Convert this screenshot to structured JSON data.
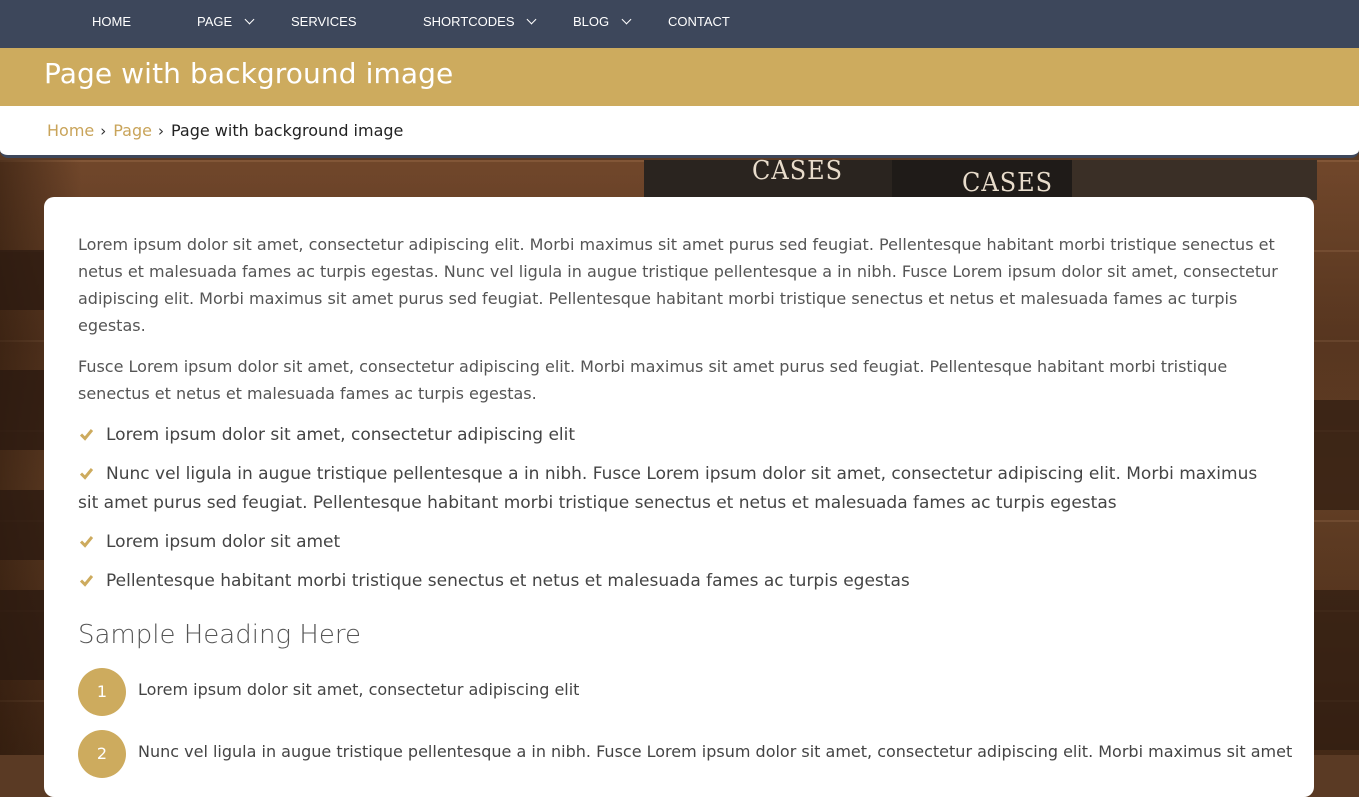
{
  "nav": {
    "items": [
      {
        "label": "HOME",
        "has_dropdown": false
      },
      {
        "label": "PAGE",
        "has_dropdown": true
      },
      {
        "label": "SERVICES",
        "has_dropdown": false
      },
      {
        "label": "SHORTCODES",
        "has_dropdown": true
      },
      {
        "label": "BLOG",
        "has_dropdown": true
      },
      {
        "label": "CONTACT",
        "has_dropdown": false
      }
    ]
  },
  "page_title": "Page with background image",
  "background_image": {
    "spine_labels": [
      "CASES",
      "CASES"
    ]
  },
  "breadcrumb": {
    "home": "Home",
    "parent": "Page",
    "current": "Page with background image",
    "separator": "›"
  },
  "content": {
    "paragraphs": [
      "Lorem ipsum dolor sit amet, consectetur adipiscing elit. Morbi maximus sit amet purus sed feugiat. Pellentesque habitant morbi tristique senectus et netus et malesuada fames ac turpis egestas. Nunc vel ligula in augue tristique pellentesque a in nibh. Fusce Lorem ipsum dolor sit amet, consectetur adipiscing elit. Morbi maximus sit amet purus sed feugiat. Pellentesque habitant morbi tristique senectus et netus et malesuada fames ac turpis egestas.",
      "Fusce Lorem ipsum dolor sit amet, consectetur adipiscing elit. Morbi maximus sit amet purus sed feugiat. Pellentesque habitant morbi tristique senectus et netus et malesuada fames ac turpis egestas."
    ],
    "checklist": [
      "Lorem ipsum dolor sit amet, consectetur adipiscing elit",
      "Nunc vel ligula in augue tristique pellentesque a in nibh. Fusce Lorem ipsum dolor sit amet, consectetur adipiscing elit. Morbi maximus sit amet purus sed feugiat. Pellentesque habitant morbi tristique senectus et netus et malesuada fames ac turpis egestas",
      "Lorem ipsum dolor sit amet",
      "Pellentesque habitant morbi tristique senectus et netus et malesuada fames ac turpis egestas"
    ],
    "heading": "Sample Heading Here",
    "numbered_list": [
      {
        "num": "1",
        "text": "Lorem ipsum dolor sit amet, consectetur adipiscing elit"
      },
      {
        "num": "2",
        "text": "Nunc vel ligula in augue tristique pellentesque a in nibh. Fusce Lorem ipsum dolor sit amet, consectetur adipiscing elit. Morbi maximus sit amet"
      }
    ]
  },
  "colors": {
    "nav_bg": "#3d475b",
    "accent_gold": "#cdab5e",
    "link_gold": "#c9a45a",
    "card_bg": "#ffffff"
  },
  "icons": {
    "checklist_marker": "check-icon",
    "dropdown_marker": "chevron-down-icon"
  }
}
